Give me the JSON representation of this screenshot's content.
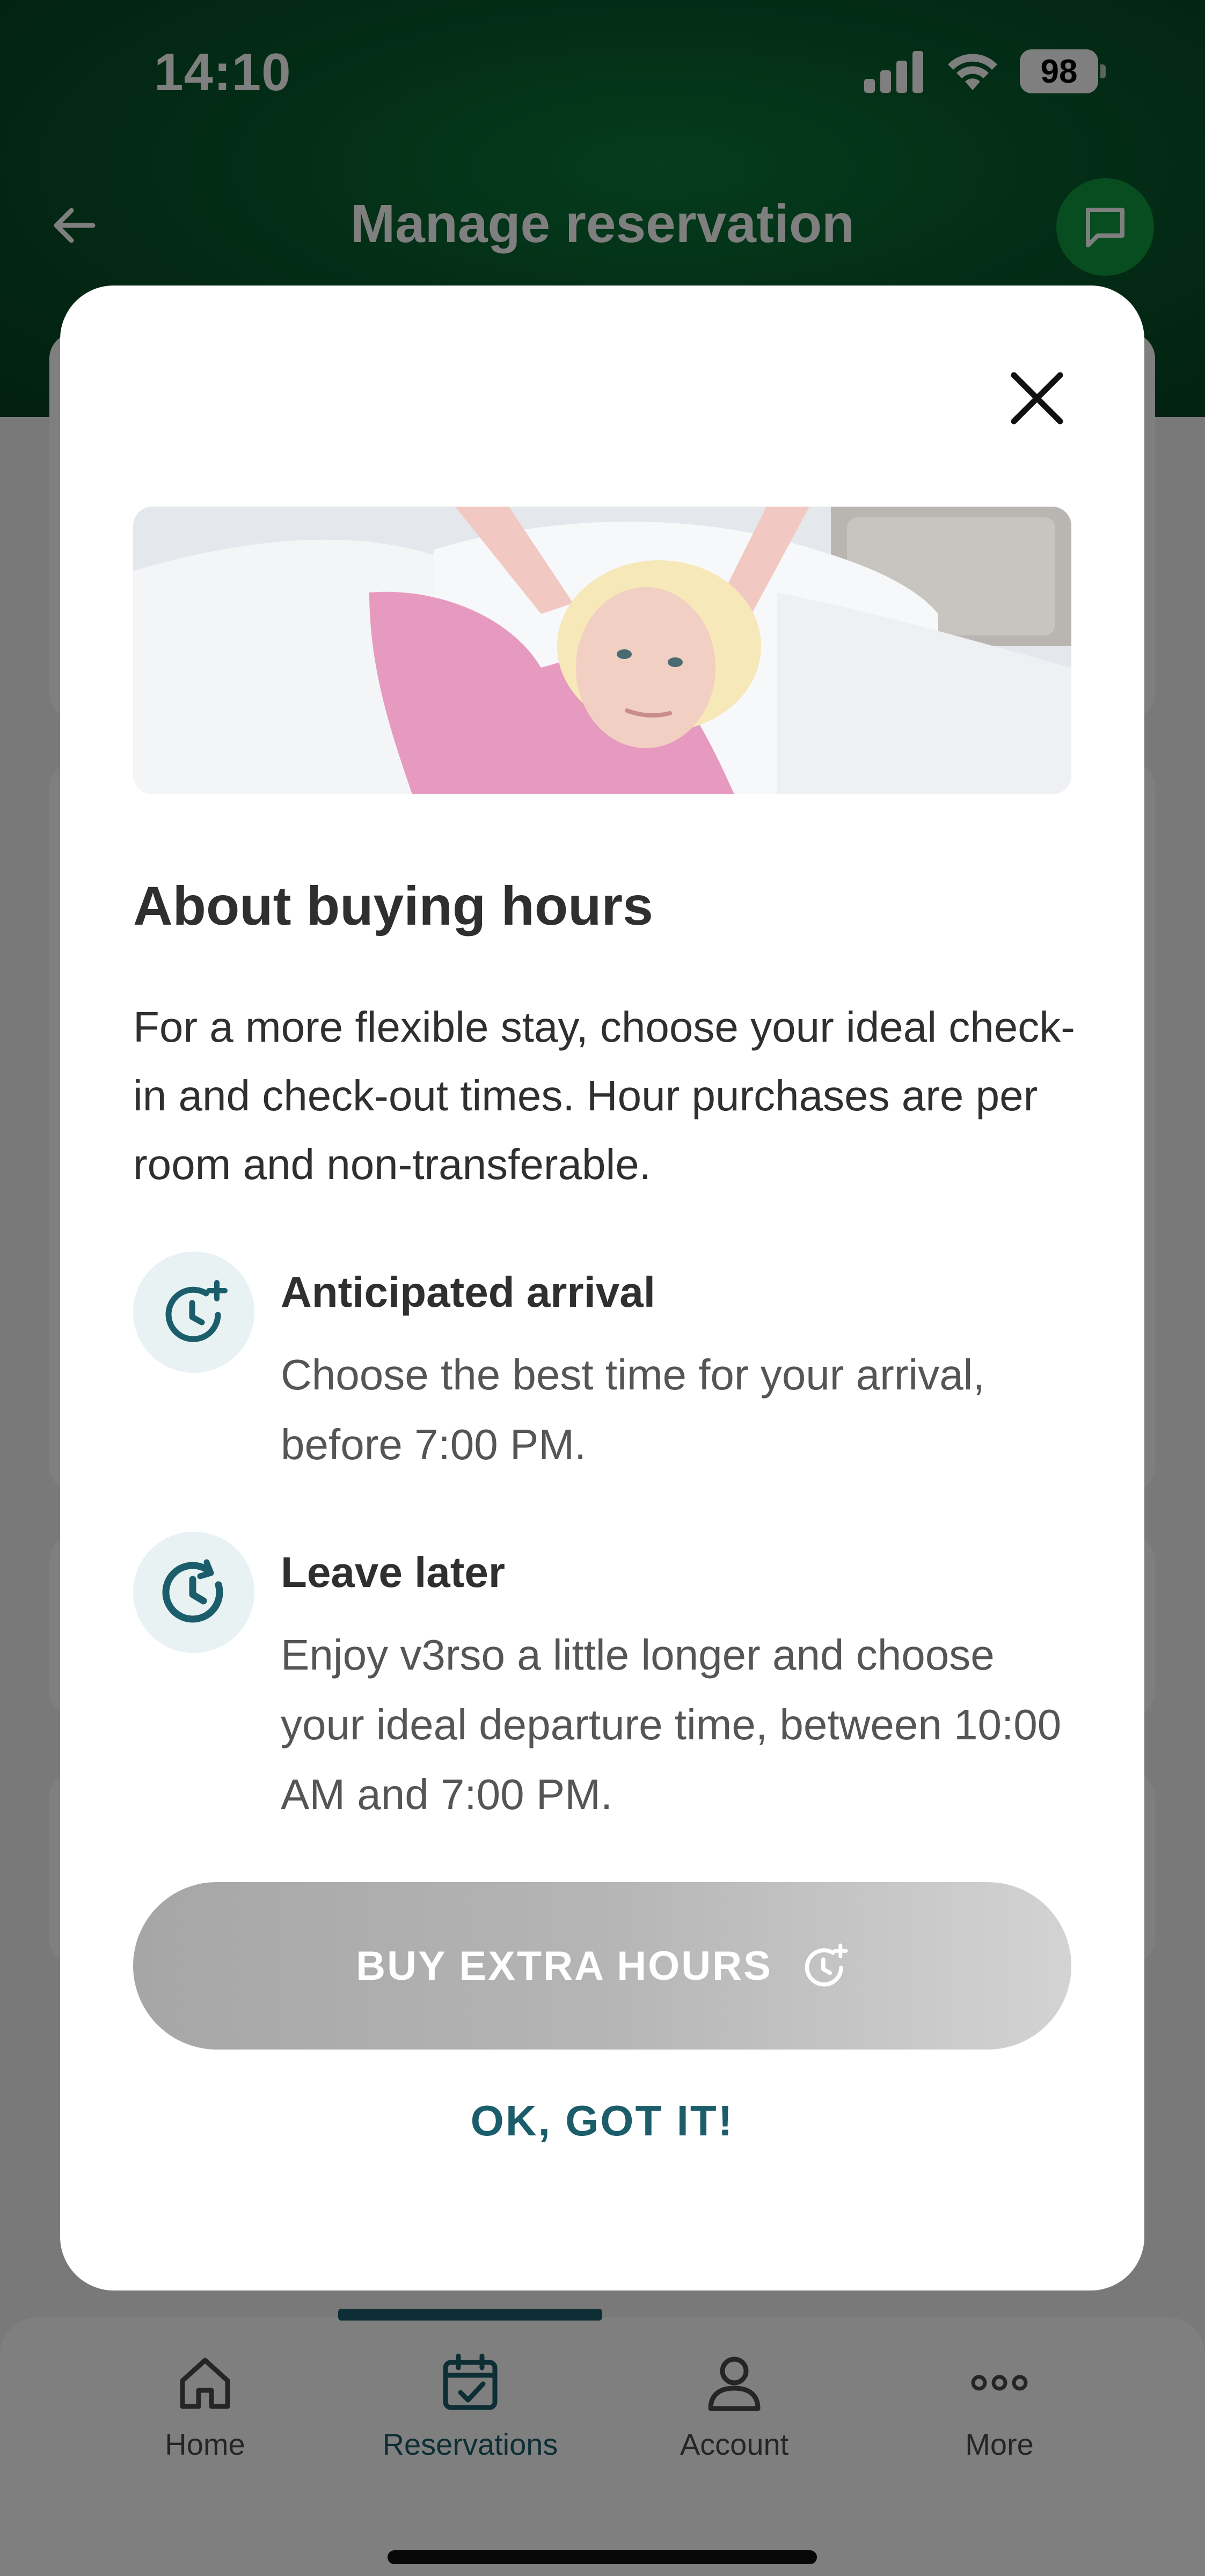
{
  "status_bar": {
    "time": "14:10",
    "battery_level": "98",
    "icons": [
      "signal-icon",
      "wifi-icon",
      "battery-icon"
    ]
  },
  "header": {
    "title": "Manage reservation",
    "back_icon": "arrow-left-icon",
    "chat_icon": "chat-icon"
  },
  "colors": {
    "header_green": "#075a2c",
    "accent_teal": "#1b5d6a",
    "chat_green": "#109a40",
    "icon_bg": "#e8f2f3"
  },
  "modal": {
    "close_icon": "close-icon",
    "title": "About buying hours",
    "body": "For a more flexible stay, choose your ideal check-in and check-out times. Hour purchases are per room and non-transferable.",
    "features": [
      {
        "icon": "clock-plus-icon",
        "title": "Anticipated arrival",
        "description": "Choose the best time for your arrival, before 7:00 PM."
      },
      {
        "icon": "clock-rotate-icon",
        "title": "Leave later",
        "description": "Enjoy v3rso a little longer and choose your ideal departure time, between 10:00 AM and 7:00 PM."
      }
    ],
    "primary_button": {
      "label": "BUY EXTRA HOURS",
      "icon": "clock-plus-icon"
    },
    "secondary_button": {
      "label": "OK, GOT IT!"
    }
  },
  "tab_bar": {
    "active": "Reservations",
    "tabs": [
      {
        "label": "Home",
        "icon": "home-icon"
      },
      {
        "label": "Reservations",
        "icon": "calendar-check-icon"
      },
      {
        "label": "Account",
        "icon": "user-icon"
      },
      {
        "label": "More",
        "icon": "more-icon"
      }
    ]
  }
}
